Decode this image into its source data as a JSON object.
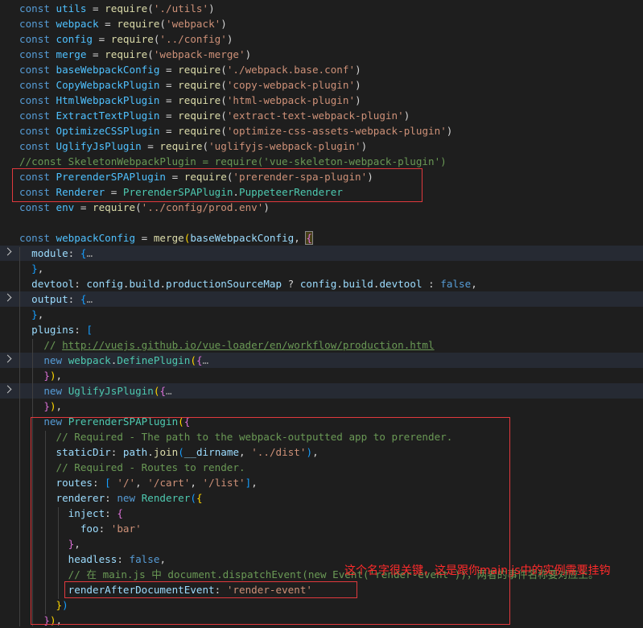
{
  "editor": {
    "lines": [
      {
        "tokens": [
          {
            "c": "kw",
            "t": "const "
          },
          {
            "c": "var",
            "t": "utils"
          },
          {
            "c": "pun",
            "t": " = "
          },
          {
            "c": "fn",
            "t": "require"
          },
          {
            "c": "pun",
            "t": "("
          },
          {
            "c": "str",
            "t": "'./utils'"
          },
          {
            "c": "pun",
            "t": ")"
          }
        ]
      },
      {
        "tokens": [
          {
            "c": "kw",
            "t": "const "
          },
          {
            "c": "var",
            "t": "webpack"
          },
          {
            "c": "pun",
            "t": " = "
          },
          {
            "c": "fn",
            "t": "require"
          },
          {
            "c": "pun",
            "t": "("
          },
          {
            "c": "str",
            "t": "'webpack'"
          },
          {
            "c": "pun",
            "t": ")"
          }
        ]
      },
      {
        "tokens": [
          {
            "c": "kw",
            "t": "const "
          },
          {
            "c": "var",
            "t": "config"
          },
          {
            "c": "pun",
            "t": " = "
          },
          {
            "c": "fn",
            "t": "require"
          },
          {
            "c": "pun",
            "t": "("
          },
          {
            "c": "str",
            "t": "'../config'"
          },
          {
            "c": "pun",
            "t": ")"
          }
        ]
      },
      {
        "tokens": [
          {
            "c": "kw",
            "t": "const "
          },
          {
            "c": "var",
            "t": "merge"
          },
          {
            "c": "pun",
            "t": " = "
          },
          {
            "c": "fn",
            "t": "require"
          },
          {
            "c": "pun",
            "t": "("
          },
          {
            "c": "str",
            "t": "'webpack-merge'"
          },
          {
            "c": "pun",
            "t": ")"
          }
        ]
      },
      {
        "tokens": [
          {
            "c": "kw",
            "t": "const "
          },
          {
            "c": "var",
            "t": "baseWebpackConfig"
          },
          {
            "c": "pun",
            "t": " = "
          },
          {
            "c": "fn",
            "t": "require"
          },
          {
            "c": "pun",
            "t": "("
          },
          {
            "c": "str",
            "t": "'./webpack.base.conf'"
          },
          {
            "c": "pun",
            "t": ")"
          }
        ]
      },
      {
        "tokens": [
          {
            "c": "kw",
            "t": "const "
          },
          {
            "c": "var",
            "t": "CopyWebpackPlugin"
          },
          {
            "c": "pun",
            "t": " = "
          },
          {
            "c": "fn",
            "t": "require"
          },
          {
            "c": "pun",
            "t": "("
          },
          {
            "c": "str",
            "t": "'copy-webpack-plugin'"
          },
          {
            "c": "pun",
            "t": ")"
          }
        ]
      },
      {
        "tokens": [
          {
            "c": "kw",
            "t": "const "
          },
          {
            "c": "var",
            "t": "HtmlWebpackPlugin"
          },
          {
            "c": "pun",
            "t": " = "
          },
          {
            "c": "fn",
            "t": "require"
          },
          {
            "c": "pun",
            "t": "("
          },
          {
            "c": "str",
            "t": "'html-webpack-plugin'"
          },
          {
            "c": "pun",
            "t": ")"
          }
        ]
      },
      {
        "tokens": [
          {
            "c": "kw",
            "t": "const "
          },
          {
            "c": "var",
            "t": "ExtractTextPlugin"
          },
          {
            "c": "pun",
            "t": " = "
          },
          {
            "c": "fn",
            "t": "require"
          },
          {
            "c": "pun",
            "t": "("
          },
          {
            "c": "str",
            "t": "'extract-text-webpack-plugin'"
          },
          {
            "c": "pun",
            "t": ")"
          }
        ]
      },
      {
        "tokens": [
          {
            "c": "kw",
            "t": "const "
          },
          {
            "c": "var",
            "t": "OptimizeCSSPlugin"
          },
          {
            "c": "pun",
            "t": " = "
          },
          {
            "c": "fn",
            "t": "require"
          },
          {
            "c": "pun",
            "t": "("
          },
          {
            "c": "str",
            "t": "'optimize-css-assets-webpack-plugin'"
          },
          {
            "c": "pun",
            "t": ")"
          }
        ]
      },
      {
        "tokens": [
          {
            "c": "kw",
            "t": "const "
          },
          {
            "c": "var",
            "t": "UglifyJsPlugin"
          },
          {
            "c": "pun",
            "t": " = "
          },
          {
            "c": "fn",
            "t": "require"
          },
          {
            "c": "pun",
            "t": "("
          },
          {
            "c": "str",
            "t": "'uglifyjs-webpack-plugin'"
          },
          {
            "c": "pun",
            "t": ")"
          }
        ]
      },
      {
        "tokens": [
          {
            "c": "cmt",
            "t": "//const SkeletonWebpackPlugin = require('vue-skeleton-webpack-plugin')"
          }
        ]
      },
      {
        "tokens": [
          {
            "c": "kw",
            "t": "const "
          },
          {
            "c": "var",
            "t": "PrerenderSPAPlugin"
          },
          {
            "c": "pun",
            "t": " = "
          },
          {
            "c": "fn",
            "t": "require"
          },
          {
            "c": "pun",
            "t": "("
          },
          {
            "c": "str",
            "t": "'prerender-spa-plugin'"
          },
          {
            "c": "pun",
            "t": ")"
          }
        ]
      },
      {
        "tokens": [
          {
            "c": "kw",
            "t": "const "
          },
          {
            "c": "var",
            "t": "Renderer"
          },
          {
            "c": "pun",
            "t": " = "
          },
          {
            "c": "cls",
            "t": "PrerenderSPAPlugin"
          },
          {
            "c": "pun",
            "t": "."
          },
          {
            "c": "cls",
            "t": "PuppeteerRenderer"
          }
        ]
      },
      {
        "tokens": [
          {
            "c": "kw",
            "t": "const "
          },
          {
            "c": "var",
            "t": "env"
          },
          {
            "c": "pun",
            "t": " = "
          },
          {
            "c": "fn",
            "t": "require"
          },
          {
            "c": "pun",
            "t": "("
          },
          {
            "c": "str",
            "t": "'../config/prod.env'"
          },
          {
            "c": "pun",
            "t": ")"
          }
        ]
      },
      {
        "tokens": []
      },
      {
        "tokens": [
          {
            "c": "kw",
            "t": "const "
          },
          {
            "c": "var",
            "t": "webpackConfig"
          },
          {
            "c": "pun",
            "t": " = "
          },
          {
            "c": "fn",
            "t": "merge"
          },
          {
            "c": "br1",
            "t": "("
          },
          {
            "c": "prop",
            "t": "baseWebpackConfig"
          },
          {
            "c": "pun",
            "t": ", "
          },
          {
            "c": "br2 hl",
            "t": "{"
          }
        ]
      },
      {
        "folded": true,
        "tokens": [
          {
            "c": "pun",
            "t": "  "
          },
          {
            "c": "prop",
            "t": "module"
          },
          {
            "c": "pun",
            "t": ": "
          },
          {
            "c": "br3",
            "t": "{"
          },
          {
            "c": "ell",
            "t": "…"
          }
        ]
      },
      {
        "tokens": [
          {
            "c": "pun",
            "t": "  "
          },
          {
            "c": "br3",
            "t": "}"
          },
          {
            "c": "pun",
            "t": ","
          }
        ]
      },
      {
        "tokens": [
          {
            "c": "pun",
            "t": "  "
          },
          {
            "c": "prop",
            "t": "devtool"
          },
          {
            "c": "pun",
            "t": ": "
          },
          {
            "c": "prop",
            "t": "config"
          },
          {
            "c": "pun",
            "t": "."
          },
          {
            "c": "prop",
            "t": "build"
          },
          {
            "c": "pun",
            "t": "."
          },
          {
            "c": "prop",
            "t": "productionSourceMap"
          },
          {
            "c": "pun",
            "t": " ? "
          },
          {
            "c": "prop",
            "t": "config"
          },
          {
            "c": "pun",
            "t": "."
          },
          {
            "c": "prop",
            "t": "build"
          },
          {
            "c": "pun",
            "t": "."
          },
          {
            "c": "prop",
            "t": "devtool"
          },
          {
            "c": "pun",
            "t": " : "
          },
          {
            "c": "bool",
            "t": "false"
          },
          {
            "c": "pun",
            "t": ","
          }
        ]
      },
      {
        "folded": true,
        "tokens": [
          {
            "c": "pun",
            "t": "  "
          },
          {
            "c": "prop",
            "t": "output"
          },
          {
            "c": "pun",
            "t": ": "
          },
          {
            "c": "br3",
            "t": "{"
          },
          {
            "c": "ell",
            "t": "…"
          }
        ]
      },
      {
        "tokens": [
          {
            "c": "pun",
            "t": "  "
          },
          {
            "c": "br3",
            "t": "}"
          },
          {
            "c": "pun",
            "t": ","
          }
        ]
      },
      {
        "tokens": [
          {
            "c": "pun",
            "t": "  "
          },
          {
            "c": "prop",
            "t": "plugins"
          },
          {
            "c": "pun",
            "t": ": "
          },
          {
            "c": "br3",
            "t": "["
          }
        ]
      },
      {
        "tokens": [
          {
            "c": "pun",
            "t": "    "
          },
          {
            "c": "cmt",
            "t": "// "
          },
          {
            "c": "lnk",
            "t": "http://vuejs.github.io/vue-loader/en/workflow/production.html"
          }
        ]
      },
      {
        "folded": true,
        "tokens": [
          {
            "c": "pun",
            "t": "    "
          },
          {
            "c": "kw",
            "t": "new "
          },
          {
            "c": "cls",
            "t": "webpack"
          },
          {
            "c": "pun",
            "t": "."
          },
          {
            "c": "cls",
            "t": "DefinePlugin"
          },
          {
            "c": "br1",
            "t": "("
          },
          {
            "c": "br2",
            "t": "{"
          },
          {
            "c": "ell",
            "t": "…"
          }
        ]
      },
      {
        "tokens": [
          {
            "c": "pun",
            "t": "    "
          },
          {
            "c": "br2",
            "t": "}"
          },
          {
            "c": "br1",
            "t": ")"
          },
          {
            "c": "pun",
            "t": ","
          }
        ]
      },
      {
        "folded": true,
        "tokens": [
          {
            "c": "pun",
            "t": "    "
          },
          {
            "c": "kw",
            "t": "new "
          },
          {
            "c": "cls",
            "t": "UglifyJsPlugin"
          },
          {
            "c": "br1",
            "t": "("
          },
          {
            "c": "br2",
            "t": "{"
          },
          {
            "c": "ell",
            "t": "…"
          }
        ]
      },
      {
        "tokens": [
          {
            "c": "pun",
            "t": "    "
          },
          {
            "c": "br2",
            "t": "}"
          },
          {
            "c": "br1",
            "t": ")"
          },
          {
            "c": "pun",
            "t": ","
          }
        ]
      },
      {
        "tokens": [
          {
            "c": "pun",
            "t": "    "
          },
          {
            "c": "kw",
            "t": "new "
          },
          {
            "c": "cls",
            "t": "PrerenderSPAPlugin"
          },
          {
            "c": "br1",
            "t": "("
          },
          {
            "c": "br2",
            "t": "{"
          }
        ]
      },
      {
        "tokens": [
          {
            "c": "pun",
            "t": "      "
          },
          {
            "c": "cmt",
            "t": "// Required - The path to the webpack-outputted app to prerender."
          }
        ]
      },
      {
        "tokens": [
          {
            "c": "pun",
            "t": "      "
          },
          {
            "c": "prop",
            "t": "staticDir"
          },
          {
            "c": "pun",
            "t": ": "
          },
          {
            "c": "prop",
            "t": "path"
          },
          {
            "c": "pun",
            "t": "."
          },
          {
            "c": "fn",
            "t": "join"
          },
          {
            "c": "br3",
            "t": "("
          },
          {
            "c": "prop",
            "t": "__dirname"
          },
          {
            "c": "pun",
            "t": ", "
          },
          {
            "c": "str",
            "t": "'../dist'"
          },
          {
            "c": "br3",
            "t": ")"
          },
          {
            "c": "pun",
            "t": ","
          }
        ]
      },
      {
        "tokens": [
          {
            "c": "pun",
            "t": "      "
          },
          {
            "c": "cmt",
            "t": "// Required - Routes to render."
          }
        ]
      },
      {
        "tokens": [
          {
            "c": "pun",
            "t": "      "
          },
          {
            "c": "prop",
            "t": "routes"
          },
          {
            "c": "pun",
            "t": ": "
          },
          {
            "c": "br3",
            "t": "["
          },
          {
            "c": "pun",
            "t": " "
          },
          {
            "c": "str",
            "t": "'/'"
          },
          {
            "c": "pun",
            "t": ", "
          },
          {
            "c": "str",
            "t": "'/cart'"
          },
          {
            "c": "pun",
            "t": ", "
          },
          {
            "c": "str",
            "t": "'/list'"
          },
          {
            "c": "br3",
            "t": "]"
          },
          {
            "c": "pun",
            "t": ","
          }
        ]
      },
      {
        "tokens": [
          {
            "c": "pun",
            "t": "      "
          },
          {
            "c": "prop",
            "t": "renderer"
          },
          {
            "c": "pun",
            "t": ": "
          },
          {
            "c": "kw",
            "t": "new "
          },
          {
            "c": "cls",
            "t": "Renderer"
          },
          {
            "c": "br3",
            "t": "("
          },
          {
            "c": "br1",
            "t": "{"
          }
        ]
      },
      {
        "tokens": [
          {
            "c": "pun",
            "t": "        "
          },
          {
            "c": "prop",
            "t": "inject"
          },
          {
            "c": "pun",
            "t": ": "
          },
          {
            "c": "br2",
            "t": "{"
          }
        ]
      },
      {
        "tokens": [
          {
            "c": "pun",
            "t": "          "
          },
          {
            "c": "prop",
            "t": "foo"
          },
          {
            "c": "pun",
            "t": ": "
          },
          {
            "c": "str",
            "t": "'bar'"
          }
        ]
      },
      {
        "tokens": [
          {
            "c": "pun",
            "t": "        "
          },
          {
            "c": "br2",
            "t": "}"
          },
          {
            "c": "pun",
            "t": ","
          }
        ]
      },
      {
        "tokens": [
          {
            "c": "pun",
            "t": "        "
          },
          {
            "c": "prop",
            "t": "headless"
          },
          {
            "c": "pun",
            "t": ": "
          },
          {
            "c": "bool",
            "t": "false"
          },
          {
            "c": "pun",
            "t": ","
          }
        ]
      },
      {
        "tokens": [
          {
            "c": "pun",
            "t": "        "
          },
          {
            "c": "cmt",
            "t": "// 在 main.js 中 document.dispatchEvent(new Event('render-event'))，两者的事件名称要对应上。"
          }
        ]
      },
      {
        "tokens": [
          {
            "c": "pun",
            "t": "        "
          },
          {
            "c": "prop",
            "t": "renderAfterDocumentEvent"
          },
          {
            "c": "pun",
            "t": ": "
          },
          {
            "c": "str",
            "t": "'render-event'"
          }
        ]
      },
      {
        "tokens": [
          {
            "c": "pun",
            "t": "      "
          },
          {
            "c": "br1",
            "t": "}"
          },
          {
            "c": "br3",
            "t": ")"
          }
        ]
      },
      {
        "tokens": [
          {
            "c": "pun",
            "t": "    "
          },
          {
            "c": "br2",
            "t": "}"
          },
          {
            "c": "br1",
            "t": ")"
          },
          {
            "c": "pun",
            "t": ","
          }
        ]
      }
    ]
  },
  "annotation": {
    "note": "这个名字很关键，这是跟你main.js中的实例需要挂钩"
  },
  "colors": {
    "background": "#1e1e1e",
    "highlight_box": "#e0393d",
    "annotation_text": "#ff2b2b"
  }
}
